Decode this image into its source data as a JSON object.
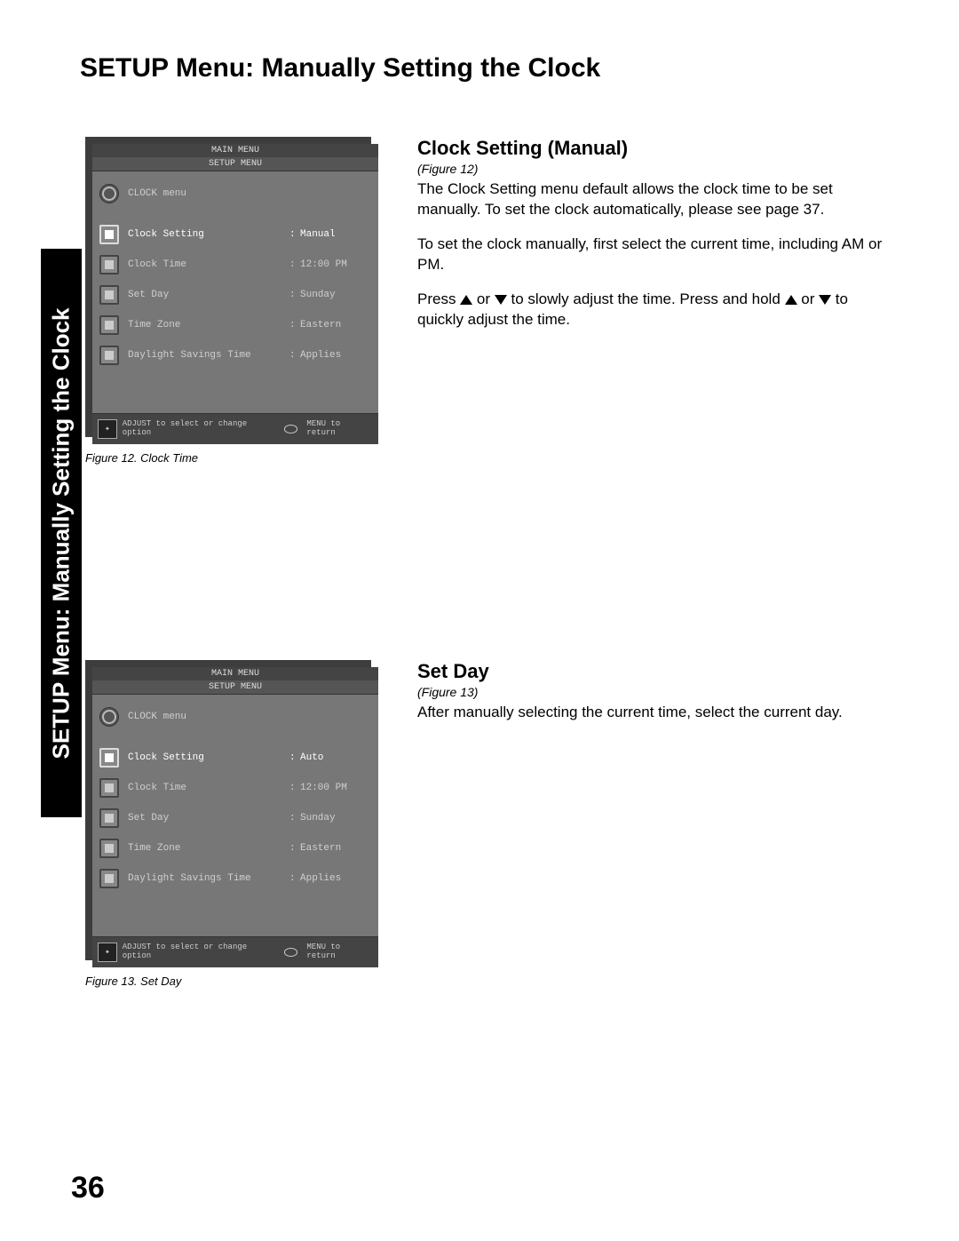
{
  "page_title": "SETUP Menu: Manually Setting the Clock",
  "side_tab": "SETUP Menu: Manually Setting the Clock",
  "page_number": "36",
  "osd": {
    "main_menu": "MAIN MENU",
    "setup_menu": "SETUP MENU",
    "clock_menu": "CLOCK menu",
    "labels": {
      "clock_setting": "Clock Setting",
      "clock_time": "Clock Time",
      "set_day": "Set Day",
      "time_zone": "Time Zone",
      "dst": "Daylight Savings Time"
    },
    "hint1": "ADJUST to select or change option",
    "hint2": "MENU to return"
  },
  "figure12": {
    "caption": "Figure 12.  Clock Time",
    "values": {
      "clock_setting": "Manual",
      "clock_time": "12:00 PM",
      "set_day": "Sunday",
      "time_zone": "Eastern",
      "dst": "Applies"
    }
  },
  "figure13": {
    "caption": "Figure 13.  Set Day",
    "values": {
      "clock_setting": "Auto",
      "clock_time": "12:00 PM",
      "set_day": "Sunday",
      "time_zone": "Eastern",
      "dst": "Applies"
    }
  },
  "section1": {
    "heading": "Clock Setting (Manual)",
    "figref": "(Figure 12)",
    "p1": "The Clock Setting menu default allows the clock time to be set manually.  To set the clock automatically, please see page 37.",
    "p2": "To set the clock manually, first select the current time, including AM or PM.",
    "p3a": "Press ",
    "p3b": " or  ",
    "p3c": " to slowly adjust the time.  Press and hold ",
    "p3d": " or ",
    "p3e": " to quickly adjust the time."
  },
  "section2": {
    "heading": "Set Day",
    "figref": "(Figure 13)",
    "p1": "After manually selecting the current time, select the current day."
  }
}
